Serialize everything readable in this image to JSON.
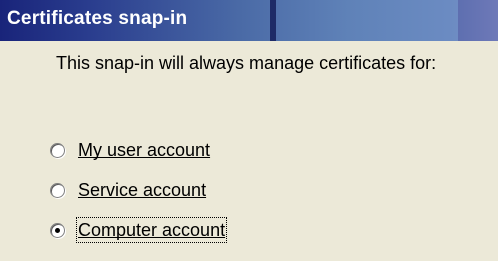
{
  "header": {
    "title": "Certificates snap-in"
  },
  "intro_text": "This snap-in will always manage certificates for:",
  "options": [
    {
      "label": "My user account",
      "selected": false
    },
    {
      "label": "Service account",
      "selected": false
    },
    {
      "label": "Computer account",
      "selected": true
    }
  ],
  "colors": {
    "title_bar_start": "#19247a",
    "title_bar_end": "#7a90c6",
    "title_text": "#ffffff",
    "panel_background": "#ece9d8"
  }
}
